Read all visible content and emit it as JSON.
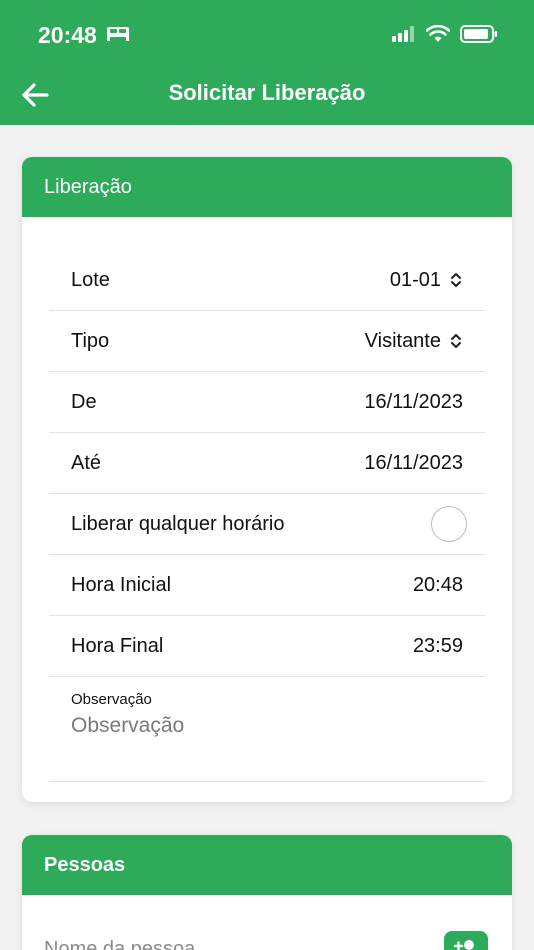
{
  "status": {
    "time": "20:48"
  },
  "header": {
    "title": "Solicitar Liberação"
  },
  "liberacao": {
    "header": "Liberação",
    "lote": {
      "label": "Lote",
      "value": "01-01"
    },
    "tipo": {
      "label": "Tipo",
      "value": "Visitante"
    },
    "de": {
      "label": "De",
      "value": "16/11/2023"
    },
    "ate": {
      "label": "Até",
      "value": "16/11/2023"
    },
    "qualquer": {
      "label": "Liberar qualquer horário"
    },
    "hora_inicial": {
      "label": "Hora Inicial",
      "value": "20:48"
    },
    "hora_final": {
      "label": "Hora Final",
      "value": "23:59"
    },
    "observacao": {
      "label": "Observação",
      "placeholder": "Observação"
    }
  },
  "pessoas": {
    "header": "Pessoas",
    "placeholder": "Nome da pessoa"
  },
  "colors": {
    "accent": "#2daa5a"
  }
}
